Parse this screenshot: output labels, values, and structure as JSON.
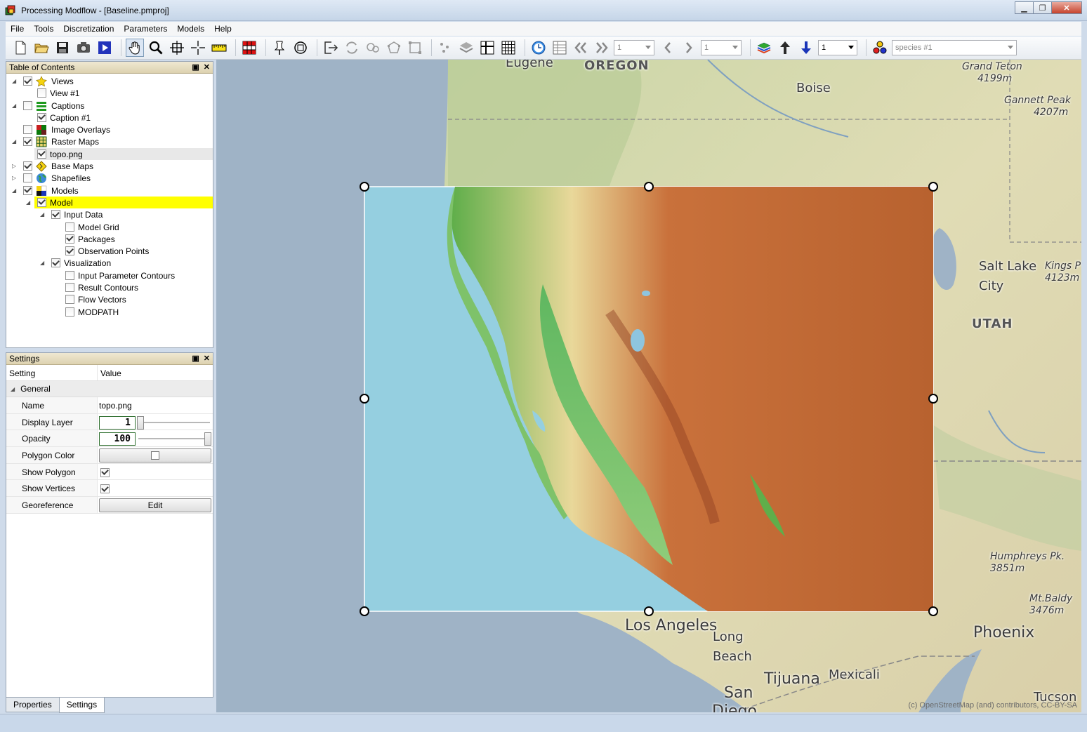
{
  "window": {
    "title": "Processing Modflow - [Baseline.pmproj]"
  },
  "menu": [
    "File",
    "Tools",
    "Discretization",
    "Parameters",
    "Models",
    "Help"
  ],
  "toolbar": {
    "combo_a": "1",
    "combo_b": "1",
    "layer_combo": "1",
    "species_combo": "species #1"
  },
  "toc": {
    "title": "Table of Contents",
    "items": [
      {
        "label": "Views",
        "checked": true,
        "level": 0,
        "expanded": true,
        "icon": "star-icon"
      },
      {
        "label": "View #1",
        "checked": false,
        "level": 1
      },
      {
        "label": "Captions",
        "checked": false,
        "level": 0,
        "expanded": true,
        "icon": "caption-icon"
      },
      {
        "label": "Caption #1",
        "checked": true,
        "level": 1
      },
      {
        "label": "Image Overlays",
        "checked": false,
        "level": 0,
        "icon": "image-overlay-icon"
      },
      {
        "label": "Raster Maps",
        "checked": true,
        "level": 0,
        "expanded": true,
        "icon": "raster-map-icon"
      },
      {
        "label": "topo.png",
        "checked": true,
        "level": 1
      },
      {
        "label": "Base Maps",
        "checked": true,
        "level": 0,
        "collapsed": true,
        "icon": "base-map-icon"
      },
      {
        "label": "Shapefiles",
        "checked": false,
        "level": 0,
        "collapsed": true,
        "icon": "globe-icon"
      },
      {
        "label": "Models",
        "checked": true,
        "level": 0,
        "expanded": true,
        "icon": "models-icon"
      },
      {
        "label": "Model",
        "checked": true,
        "level": 1,
        "expanded": true
      },
      {
        "label": "Input Data",
        "checked": true,
        "level": 2,
        "expanded": true
      },
      {
        "label": "Model Grid",
        "checked": false,
        "level": 3
      },
      {
        "label": "Packages",
        "checked": true,
        "level": 3
      },
      {
        "label": "Observation Points",
        "checked": true,
        "level": 3
      },
      {
        "label": "Visualization",
        "checked": true,
        "level": 2,
        "expanded": true
      },
      {
        "label": "Input Parameter Contours",
        "checked": false,
        "level": 3
      },
      {
        "label": "Result Contours",
        "checked": false,
        "level": 3
      },
      {
        "label": "Flow Vectors",
        "checked": false,
        "level": 3
      },
      {
        "label": "MODPATH",
        "checked": false,
        "level": 3
      }
    ]
  },
  "settings": {
    "title": "Settings",
    "col_setting": "Setting",
    "col_value": "Value",
    "category": "General",
    "name_label": "Name",
    "name_value": "topo.png",
    "display_layer_label": "Display Layer",
    "display_layer_value": "1",
    "opacity_label": "Opacity",
    "opacity_value": "100",
    "polygon_color_label": "Polygon Color",
    "show_polygon_label": "Show Polygon",
    "show_vertices_label": "Show Vertices",
    "georeference_label": "Georeference",
    "edit_label": "Edit"
  },
  "tabs": {
    "properties": "Properties",
    "settings": "Settings"
  },
  "map": {
    "labels": {
      "eugene": "Eugene",
      "oregon": "OREGON",
      "boise": "Boise",
      "grand_teton": "Grand Teton",
      "grand_teton_elev": "4199m",
      "gannett": "Gannett Peak",
      "gannett_elev": "4207m",
      "salt_lake": "Salt Lake",
      "city": "City",
      "kings": "Kings P",
      "kings_elev": "4123m",
      "utah": "UTAH",
      "los_angeles": "Los Angeles",
      "long": "Long",
      "beach": "Beach",
      "tijuana": "Tijuana",
      "mexicali": "Mexicali",
      "san": "San",
      "diego": "Diego",
      "humphreys": "Humphreys Pk.",
      "humphreys_elev": "3851m",
      "mtbaldy": "Mt.Baldy",
      "mtbaldy_elev": "3476m",
      "phoenix": "Phoenix",
      "tucson": "Tucson"
    },
    "attribution": "(c) OpenStreetMap (and) contributors, CC-BY-SA"
  }
}
